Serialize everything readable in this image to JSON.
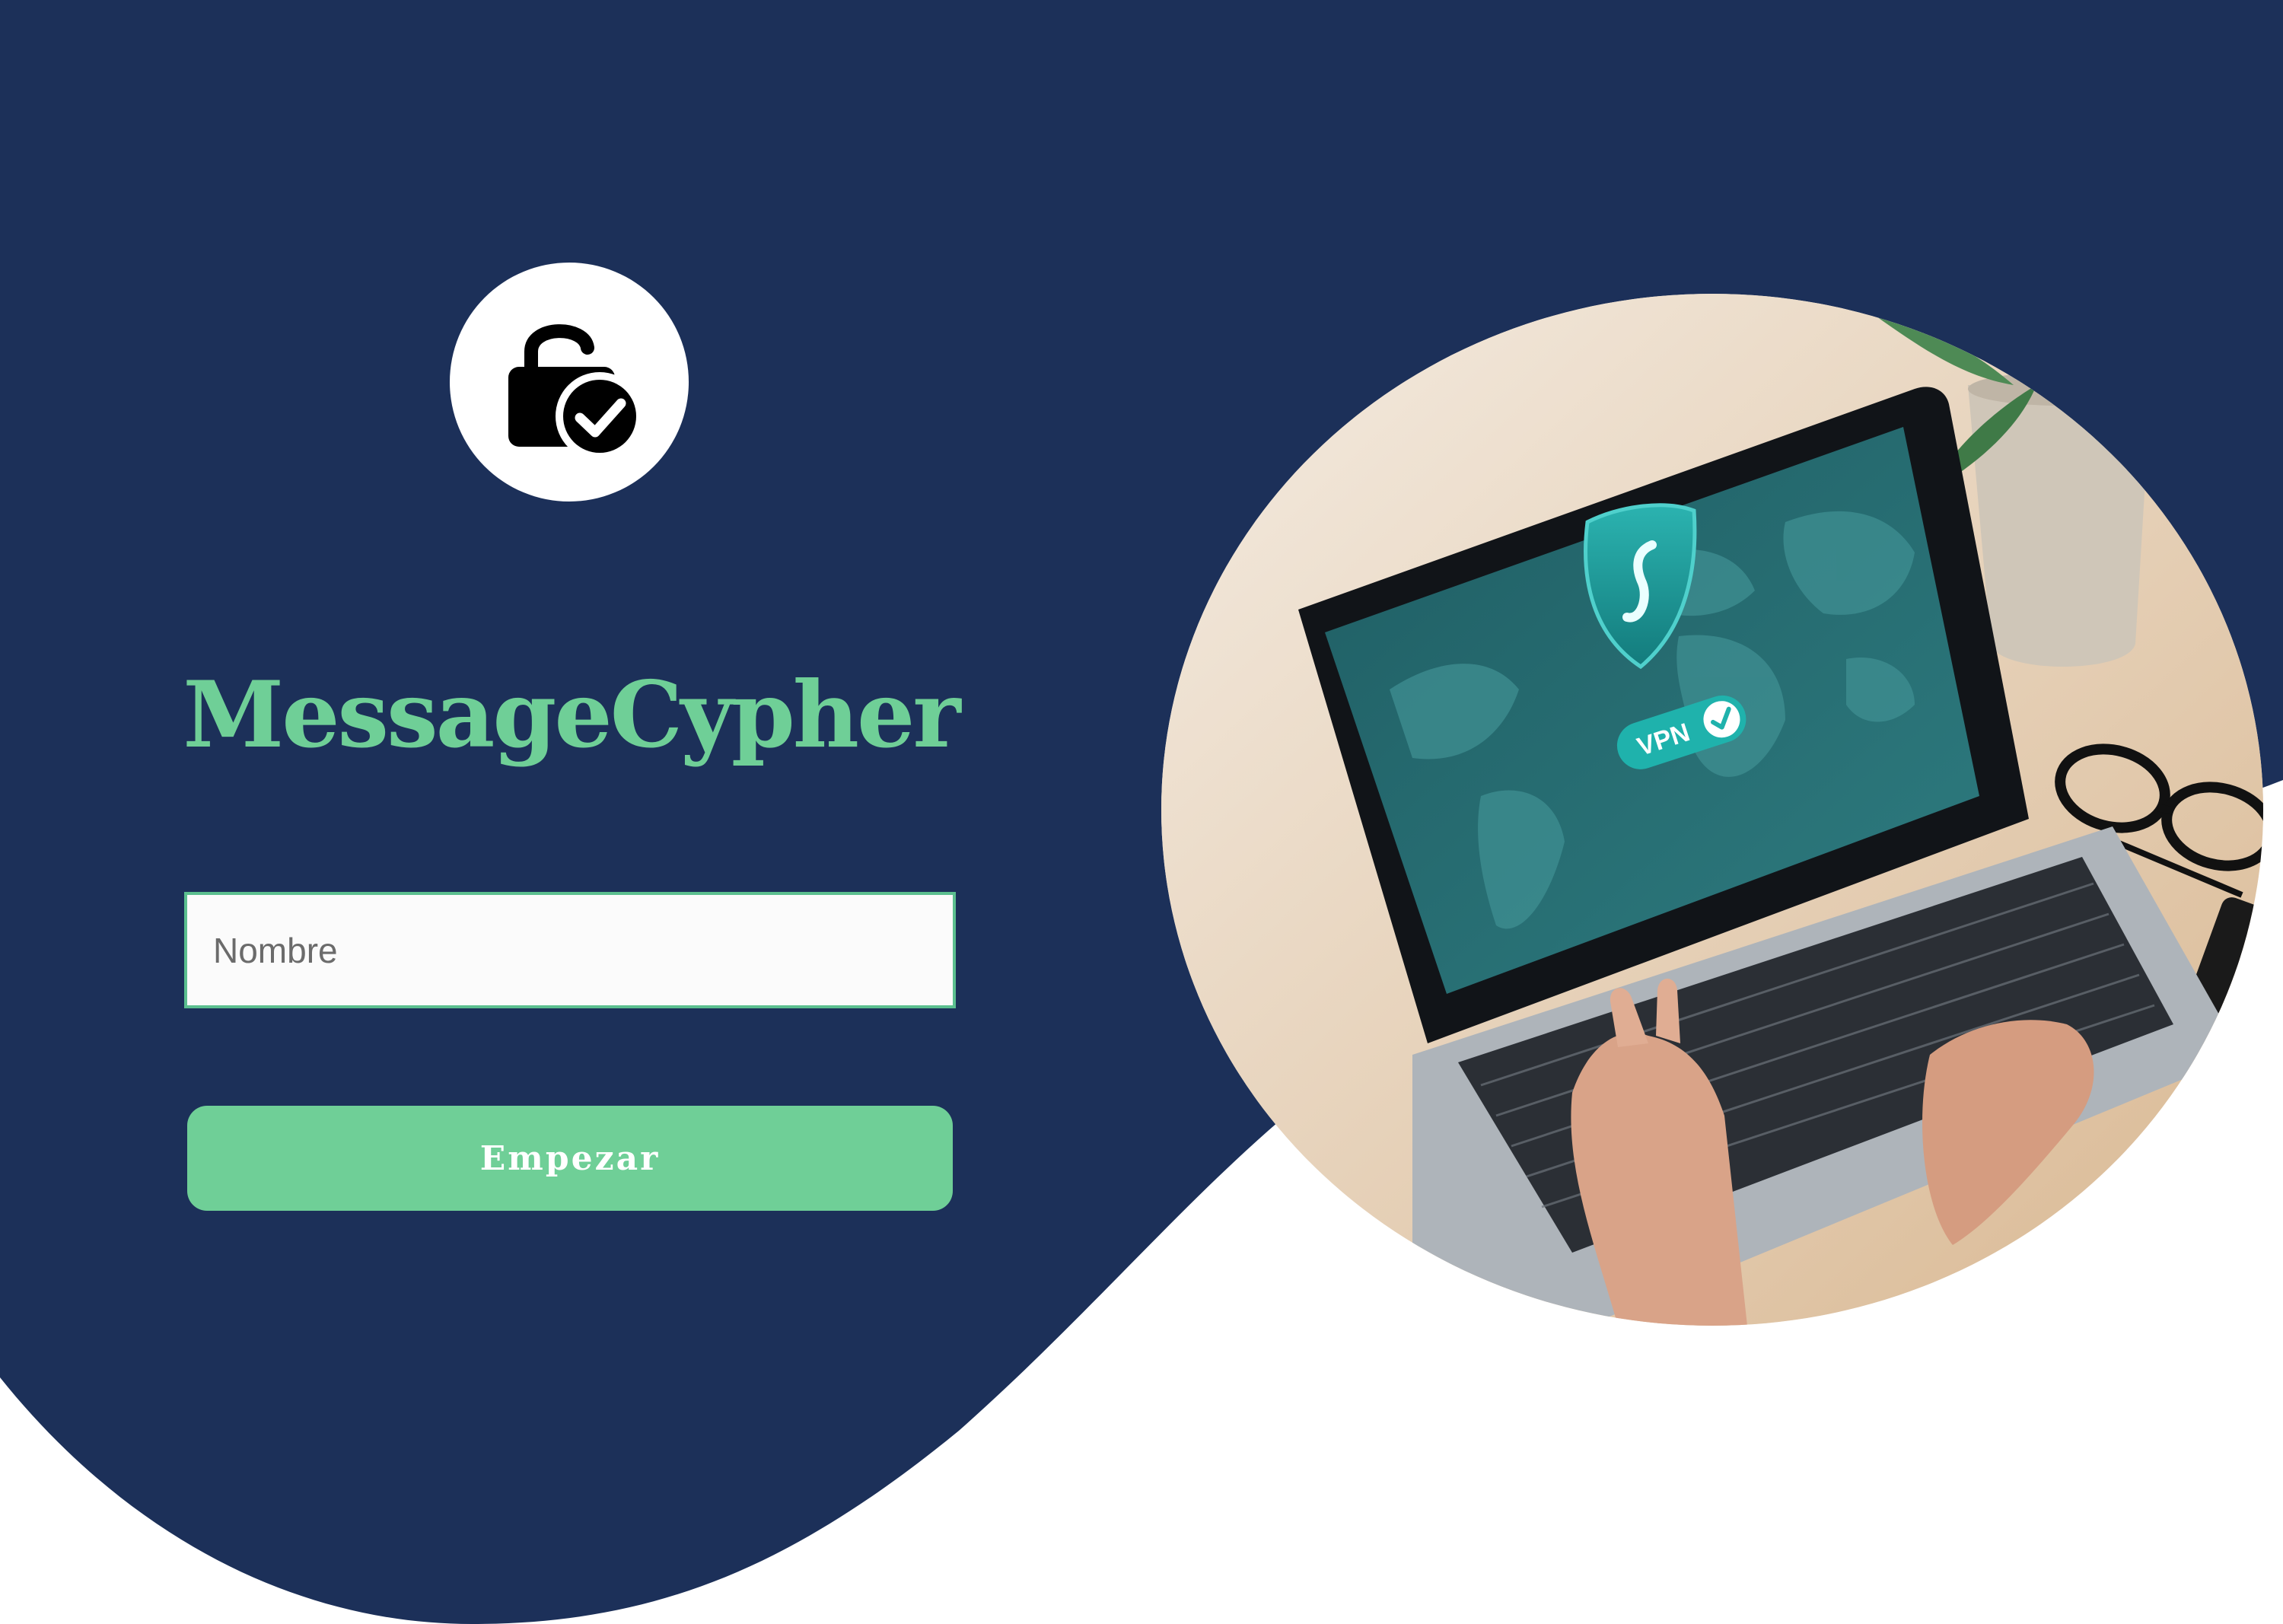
{
  "app": {
    "title": "MessageCypher",
    "logo_icon": "unlock-check-icon"
  },
  "form": {
    "name_placeholder": "Nombre",
    "name_value": "",
    "submit_label": "Empezar"
  },
  "hero": {
    "image_subject": "laptop-vpn-photo",
    "vpn_badge_text": "VPN",
    "shield_icon": "shield-icon",
    "check_icon": "check-icon"
  },
  "colors": {
    "background_dark": "#1c3059",
    "accent_green": "#6fcf97",
    "input_border": "#5bbf8f",
    "page_white": "#ffffff"
  }
}
